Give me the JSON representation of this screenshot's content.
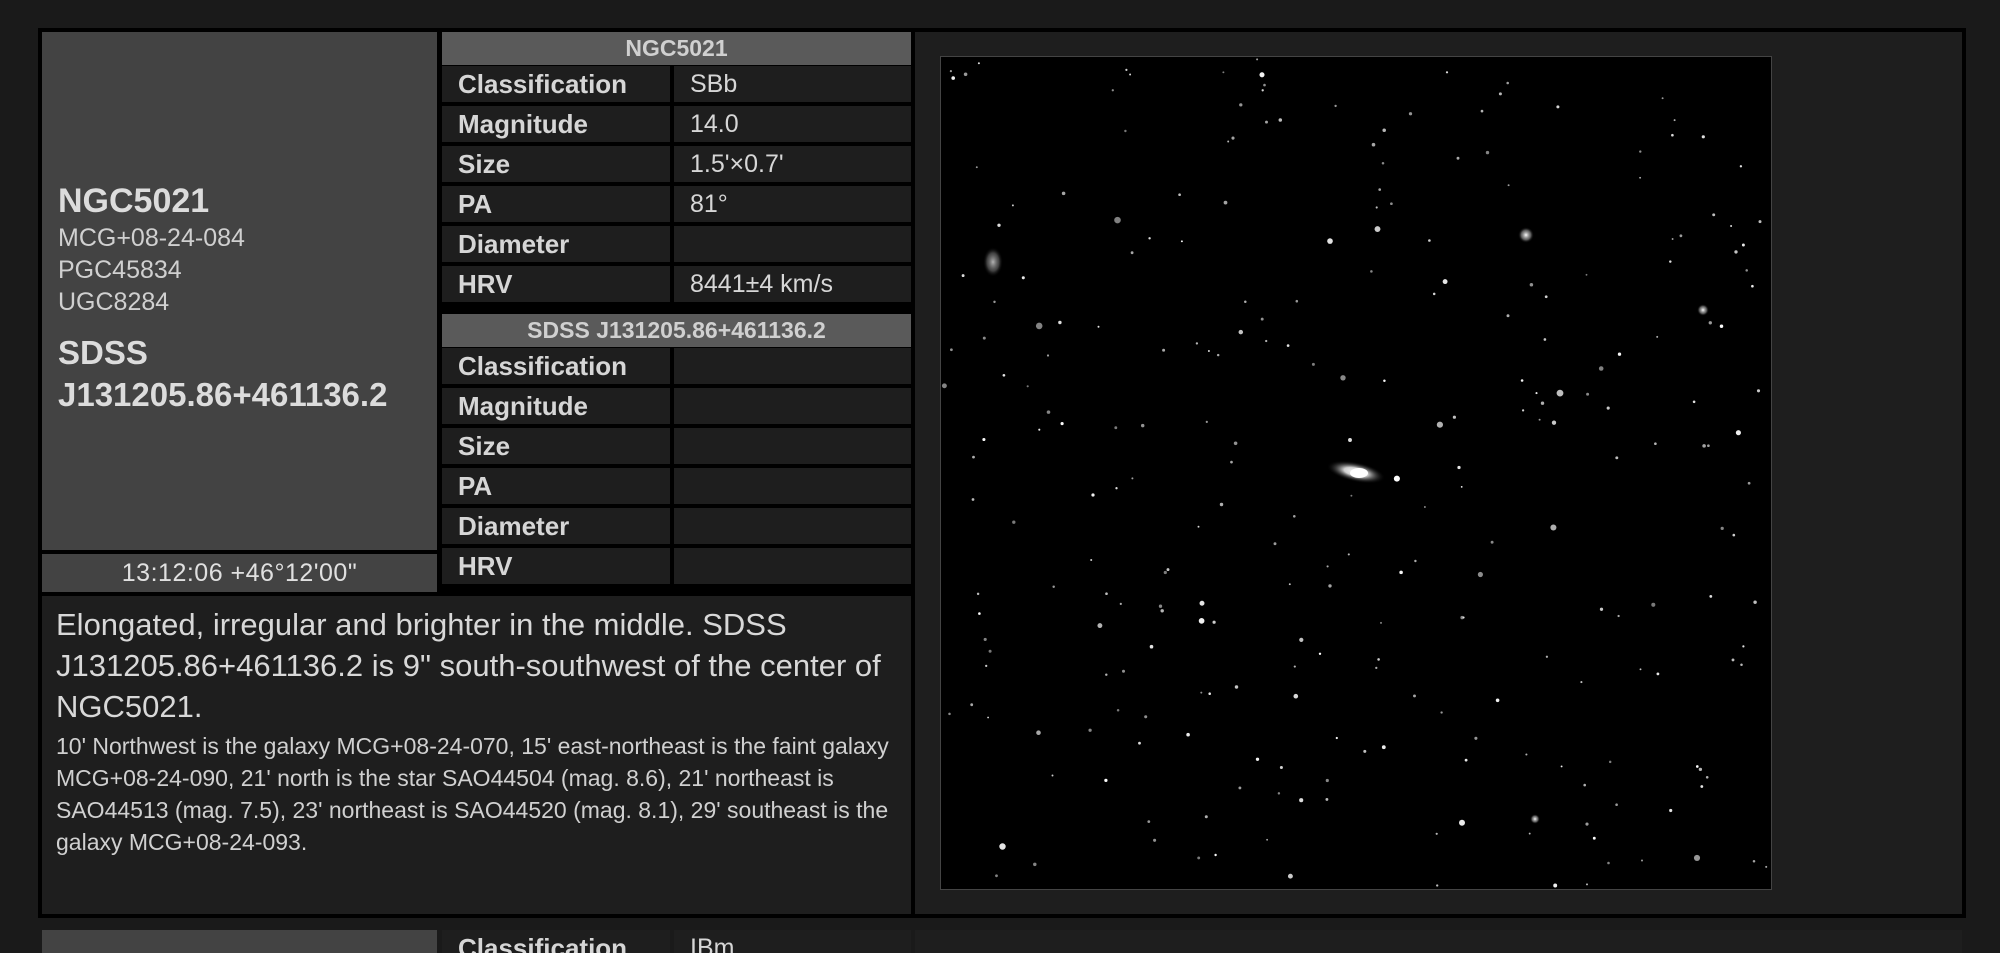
{
  "object": {
    "primary_name": "NGC5021",
    "aliases": [
      "MCG+08-24-084",
      "PGC45834",
      "UGC8284"
    ],
    "secondary_name": "SDSS J131205.86+461136.2",
    "coordinates": "13:12:06 +46°12'00\""
  },
  "table_primary": {
    "title": "NGC5021",
    "rows": [
      {
        "label": "Classification",
        "value": "SBb"
      },
      {
        "label": "Magnitude",
        "value": "14.0"
      },
      {
        "label": "Size",
        "value": "1.5'×0.7'"
      },
      {
        "label": "PA",
        "value": "81°"
      },
      {
        "label": "Diameter",
        "value": ""
      },
      {
        "label": "HRV",
        "value": "8441±4 km/s"
      }
    ]
  },
  "table_secondary": {
    "title": "SDSS J131205.86+461136.2",
    "rows": [
      {
        "label": "Classification",
        "value": ""
      },
      {
        "label": "Magnitude",
        "value": ""
      },
      {
        "label": "Size",
        "value": ""
      },
      {
        "label": "PA",
        "value": ""
      },
      {
        "label": "Diameter",
        "value": ""
      },
      {
        "label": "HRV",
        "value": ""
      }
    ]
  },
  "description": {
    "main": "Elongated, irregular and brighter in the middle. SDSS J131205.86+461136.2 is 9\" south-southwest of the center of NGC5021.",
    "notes": "10' Northwest is the galaxy MCG+08-24-070, 15' east-northeast is the faint galaxy MCG+08-24-090, 21' north is the star SAO44504 (mag. 8.6), 21' northeast is SAO44513 (mag. 7.5), 23' northeast is SAO44520 (mag. 8.1), 29' southeast is the galaxy MCG+08-24-093."
  },
  "next_entry": {
    "first_label": "Classification",
    "first_value": "IBm"
  },
  "colors": {
    "id_panel": "#434343",
    "table_header": "#5a5a5a",
    "cell": "#1e1e1e",
    "background": "#1a1a1a"
  }
}
